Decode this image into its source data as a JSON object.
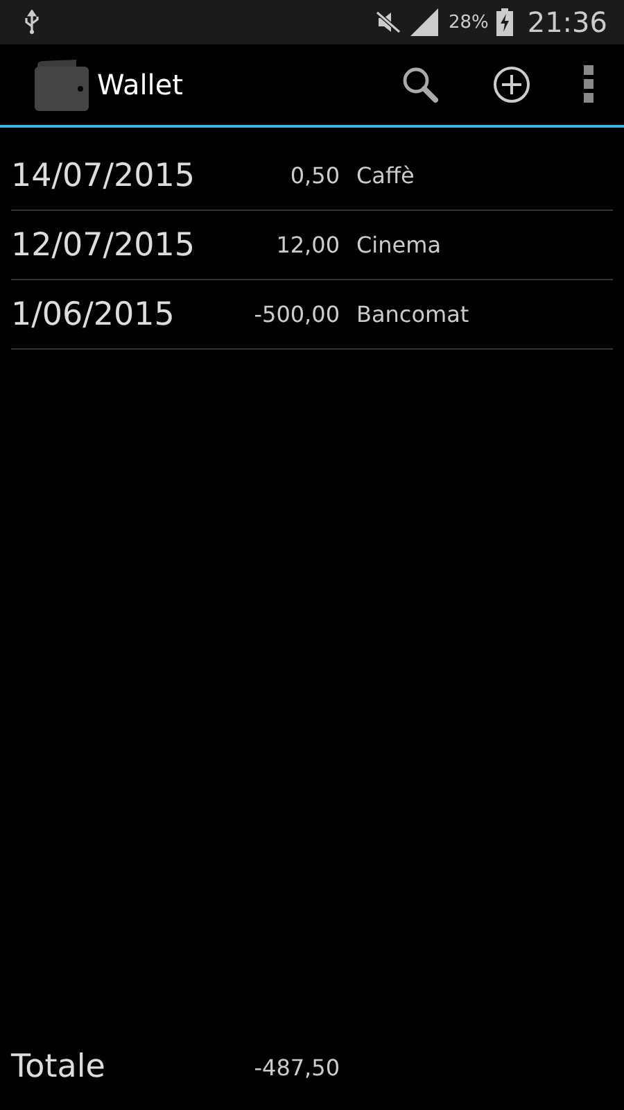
{
  "status_bar": {
    "battery": "28%",
    "time": "21:36"
  },
  "action_bar": {
    "title": "Wallet"
  },
  "transactions": [
    {
      "date": "14/07/2015",
      "amount": "0,50",
      "description": "Caffè"
    },
    {
      "date": "12/07/2015",
      "amount": "12,00",
      "description": "Cinema"
    },
    {
      "date": "1/06/2015",
      "amount": "-500,00",
      "description": "Bancomat"
    }
  ],
  "total": {
    "label": "Totale",
    "amount": "-487,50"
  }
}
